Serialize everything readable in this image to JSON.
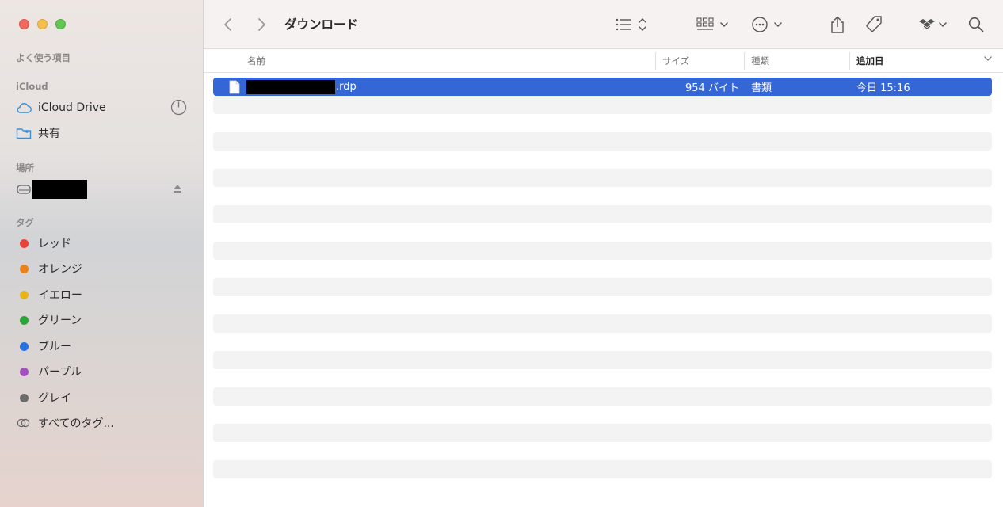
{
  "window": {
    "title": "ダウンロード"
  },
  "sidebar": {
    "favorites_title": "よく使う項目",
    "icloud_title": "iCloud",
    "icloud_items": [
      {
        "label": "iCloud Drive",
        "icon": "cloud-icon"
      },
      {
        "label": "共有",
        "icon": "shared-folder-icon"
      }
    ],
    "locations_title": "場所",
    "tags_title": "タグ",
    "tags": [
      {
        "label": "レッド",
        "color": "#e8423b"
      },
      {
        "label": "オレンジ",
        "color": "#ea8217"
      },
      {
        "label": "イエロー",
        "color": "#e9b418"
      },
      {
        "label": "グリーン",
        "color": "#2aa537"
      },
      {
        "label": "ブルー",
        "color": "#2970e2"
      },
      {
        "label": "パープル",
        "color": "#a34fc0"
      },
      {
        "label": "グレイ",
        "color": "#6b6b6b"
      }
    ],
    "all_tags": "すべてのタグ..."
  },
  "columns": {
    "name": "名前",
    "size": "サイズ",
    "kind": "種類",
    "date_added": "追加日"
  },
  "files": [
    {
      "name_suffix": ".rdp",
      "size": "954 バイト",
      "kind": "書類",
      "date_added": "今日 15:16"
    }
  ],
  "colors": {
    "selection": "#3466d6",
    "stripe": "#f3f3f3"
  }
}
